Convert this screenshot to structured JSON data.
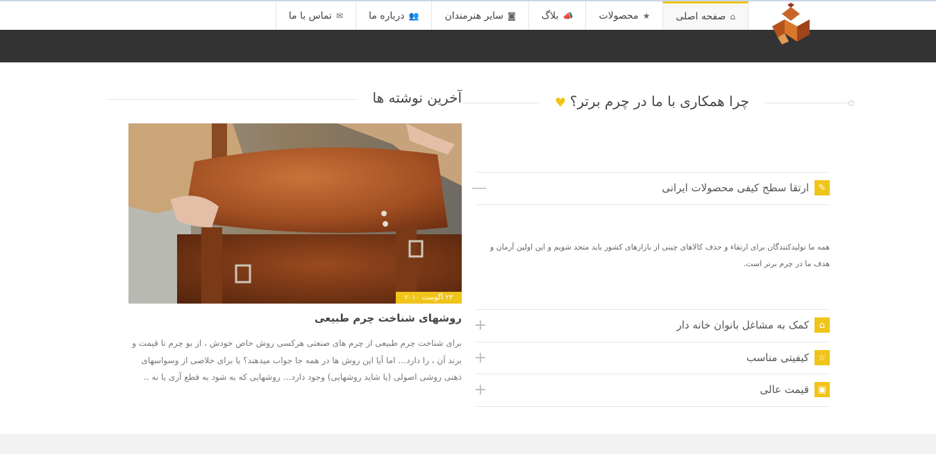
{
  "nav": {
    "items": [
      {
        "label": "صفحه اصلی",
        "icon": "home-icon",
        "glyph": "⌂",
        "active": true
      },
      {
        "label": "محصولات",
        "icon": "star-icon",
        "glyph": "★",
        "active": false
      },
      {
        "label": "بلاگ",
        "icon": "bullhorn-icon",
        "glyph": "📣",
        "active": false
      },
      {
        "label": "سایر هنرمندان",
        "icon": "camera-icon",
        "glyph": "◙",
        "active": false
      },
      {
        "label": "درباره ما",
        "icon": "users-icon",
        "glyph": "👥",
        "active": false
      },
      {
        "label": "تماس با ما",
        "icon": "envelope-icon",
        "glyph": "✉",
        "active": false
      }
    ]
  },
  "why": {
    "title": "چرا همکاری با ما در چرم برتر؟",
    "heart_icon": "heart-icon",
    "accordion": [
      {
        "title": "ارتقا سطح کیفی محصولات ایرانی",
        "icon": "pencil-icon",
        "glyph": "✎",
        "toggle": "—",
        "open": true,
        "body": "همه ما تولیدکنندگان برای ارتقاء و حذف کالاهای چینی از بازارهای کشور باید متحد شویم و این اولین آرمان و هدف ما در چرم برتر است."
      },
      {
        "title": "کمک به مشاغل بانوان خانه دار",
        "icon": "home-icon",
        "glyph": "⌂",
        "toggle": "+",
        "open": false
      },
      {
        "title": "کیفیتی مناسب",
        "icon": "star-outline-icon",
        "glyph": "☆",
        "toggle": "+",
        "open": false
      },
      {
        "title": "قیمت عالی",
        "icon": "money-icon",
        "glyph": "▣",
        "toggle": "+",
        "open": false
      }
    ]
  },
  "latest": {
    "title": "آخرین نوشته ها",
    "post": {
      "date": "۲۳ آگوست ۲۰۱۰",
      "title": "روشهای شناخت چرم طبیعی",
      "excerpt": "برای شناخت چرم طبیعی از چرم های صنعتی هرکسی روش خاص خودش ، از بو چرم تا قیمت و برند آن ، را دارد… اما آیا این روش ها در همه جا جواب میدهند؟ یا برای خلاصی از وسواسهای ذهنی روشی اصولی (یا شاید روشهایی) وجود دارد… روشهایی که به شود به قطع آری یا نه .."
    }
  },
  "colors": {
    "accent": "#f0c419",
    "dark_band": "#333333",
    "footer": "#f2f2f2"
  }
}
